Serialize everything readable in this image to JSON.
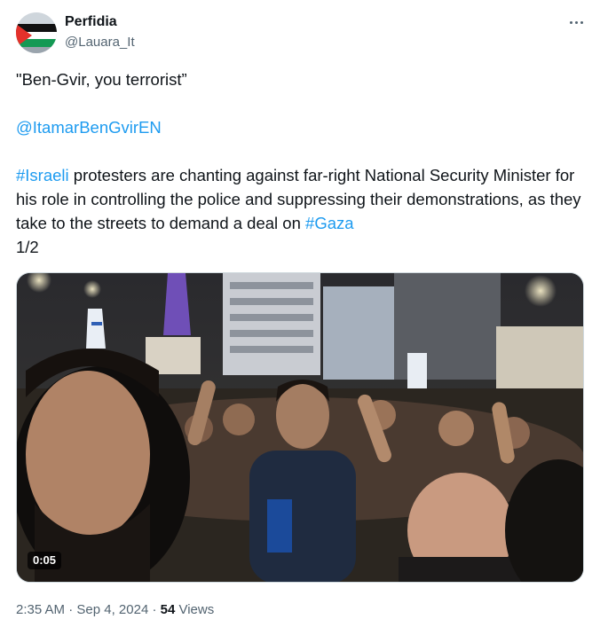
{
  "author": {
    "name": "Perfidia",
    "handle": "@Lauara_It",
    "avatar": "palestinian-flag-avatar"
  },
  "more_icon": "more-horizontal-icon",
  "tweet": {
    "quote": "\"Ben-Gvir, you terrorist”",
    "mention": "@ItamarBenGvirEN",
    "hashtag_israeli": "#Israeli",
    "body_1": " protesters are chanting against far-right National Security Minister for his role in controlling the police and suppressing their demonstrations, as they take to the streets to demand a deal on ",
    "hashtag_gaza": "#Gaza",
    "thread_index": "1/2"
  },
  "media": {
    "type": "video",
    "duration": "0:05"
  },
  "meta": {
    "time": "2:35 AM",
    "separator": " · ",
    "date": "Sep 4, 2024",
    "views_count": "54",
    "views_label": " Views"
  },
  "colors": {
    "link": "#1d9bf0",
    "text": "#0f1419",
    "secondary": "#536471"
  }
}
